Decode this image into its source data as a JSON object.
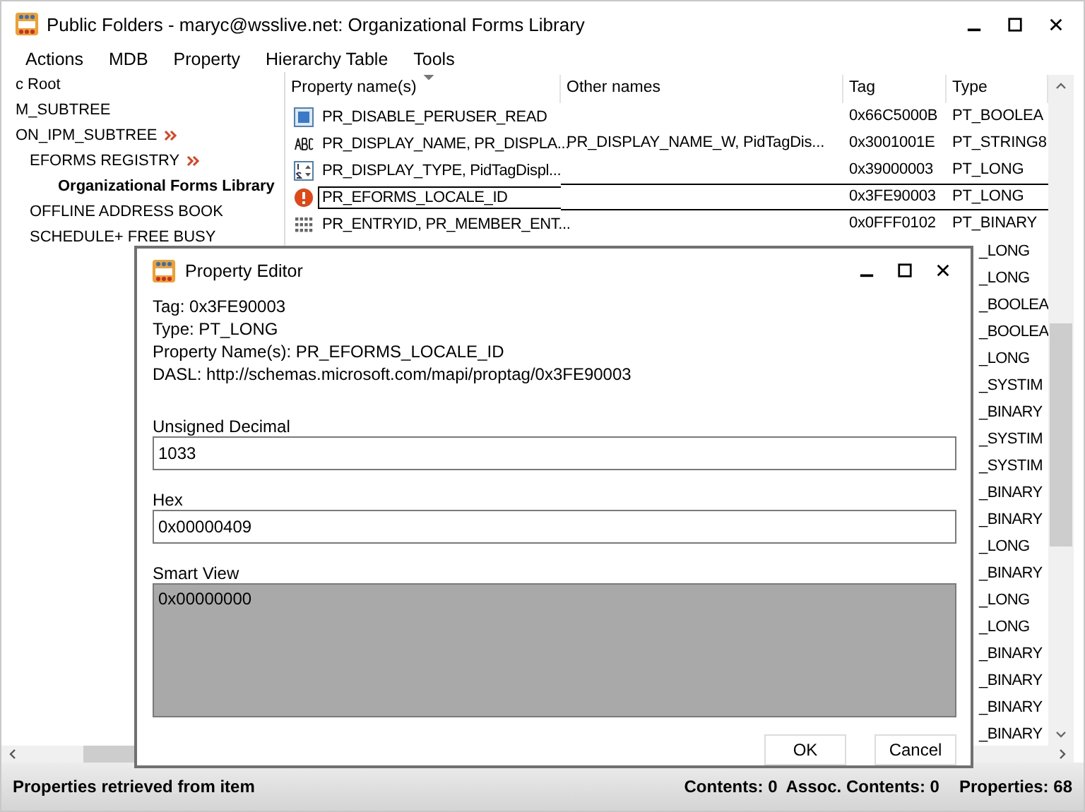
{
  "window": {
    "title": "Public Folders - maryc@wsslive.net: Organizational Forms Library"
  },
  "menu": [
    "Actions",
    "MDB",
    "Property",
    "Hierarchy Table",
    "Tools"
  ],
  "tree": [
    {
      "label": "c Root",
      "flagged": false,
      "selected": false
    },
    {
      "label": "M_SUBTREE",
      "flagged": false,
      "selected": false
    },
    {
      "label": "ON_IPM_SUBTREE",
      "flagged": true,
      "selected": false,
      "children": [
        {
          "label": "EFORMS REGISTRY",
          "flagged": true,
          "selected": false,
          "children": [
            {
              "label": "Organizational Forms Library",
              "flagged": false,
              "selected": true
            }
          ]
        },
        {
          "label": "OFFLINE ADDRESS BOOK",
          "flagged": false,
          "selected": false
        },
        {
          "label": "SCHEDULE+ FREE BUSY",
          "flagged": false,
          "selected": false
        }
      ]
    }
  ],
  "table": {
    "columns": [
      "Property name(s)",
      "Other names",
      "Tag",
      "Type"
    ],
    "rows": [
      {
        "kind": "boolean",
        "name": "PR_DISABLE_PERUSER_READ",
        "tag": "0x66C5000B",
        "type": "PT_BOOLEA",
        "selected": false
      },
      {
        "kind": "string",
        "name": "PR_DISPLAY_NAME, PR_DISPLA...",
        "other": "PR_DISPLAY_NAME_W, PidTagDis...",
        "tag": "0x3001001E",
        "type": "PT_STRING8",
        "selected": false
      },
      {
        "kind": "number",
        "name": "PR_DISPLAY_TYPE, PidTagDispl...",
        "tag": "0x39000003",
        "type": "PT_LONG",
        "selected": false
      },
      {
        "kind": "error",
        "name": "PR_EFORMS_LOCALE_ID",
        "tag": "0x3FE90003",
        "type": "PT_LONG",
        "selected": true
      },
      {
        "kind": "binary",
        "name": "PR_ENTRYID, PR_MEMBER_ENT...",
        "tag": "0x0FFF0102",
        "type": "PT_BINARY",
        "selected": false
      },
      {
        "kind": "covered",
        "type": "_LONG"
      },
      {
        "kind": "covered",
        "type": "_LONG"
      },
      {
        "kind": "covered",
        "type": "_BOOLEA"
      },
      {
        "kind": "covered",
        "type": "_BOOLEA"
      },
      {
        "kind": "covered",
        "type": "_LONG"
      },
      {
        "kind": "covered",
        "type": "_SYSTIM"
      },
      {
        "kind": "covered",
        "type": "_BINARY"
      },
      {
        "kind": "covered",
        "type": "_SYSTIM"
      },
      {
        "kind": "covered",
        "type": "_SYSTIM"
      },
      {
        "kind": "covered",
        "type": "_BINARY"
      },
      {
        "kind": "covered",
        "type": "_BINARY"
      },
      {
        "kind": "covered",
        "type": "_LONG"
      },
      {
        "kind": "covered",
        "type": "_BINARY"
      },
      {
        "kind": "covered",
        "type": "_LONG"
      },
      {
        "kind": "covered",
        "type": "_LONG"
      },
      {
        "kind": "covered",
        "type": "_BINARY"
      },
      {
        "kind": "covered",
        "type": "_BINARY"
      },
      {
        "kind": "covered",
        "type": "_BINARY"
      },
      {
        "kind": "covered",
        "type": "_BINARY"
      }
    ]
  },
  "dialog": {
    "title": "Property Editor",
    "info": [
      "Tag: 0x3FE90003",
      "Type: PT_LONG",
      "Property Name(s): PR_EFORMS_LOCALE_ID",
      "DASL: http://schemas.microsoft.com/mapi/proptag/0x3FE90003"
    ],
    "fields": [
      {
        "label": "Unsigned Decimal",
        "value": "1033",
        "disabled": false
      },
      {
        "label": "Hex",
        "value": "0x00000409",
        "disabled": false
      },
      {
        "label": "Smart View",
        "value": "0x00000000",
        "disabled": true
      }
    ],
    "buttons": [
      "OK",
      "Cancel"
    ]
  },
  "status_bar": {
    "message": "Properties retrieved from item",
    "counts": [
      "Contents: 0",
      "Assoc. Contents: 0",
      "Properties: 68"
    ]
  }
}
